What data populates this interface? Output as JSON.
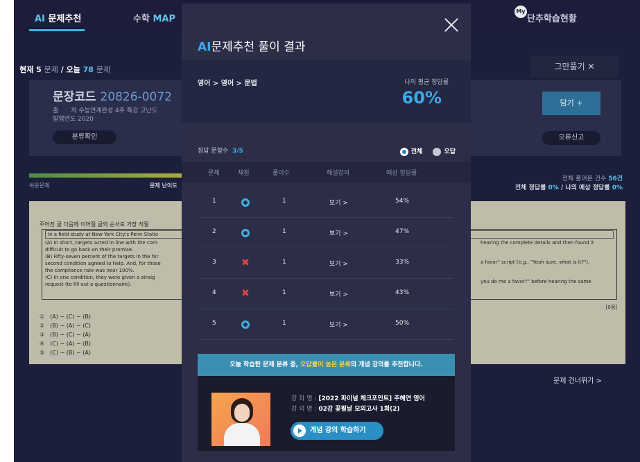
{
  "background": {
    "nav": {
      "tab1_prefix": "AI",
      "tab1_label": "문제추천",
      "tab2_label": "수학",
      "tab2_suffix": "MAP",
      "my_badge": "My",
      "tab3_label": "단추학습현황"
    },
    "counter": {
      "current_label": "현재",
      "current_num": "5",
      "current_unit": "문제",
      "sep": "/",
      "today_label": "오늘",
      "today_num": "78",
      "today_unit": "문제"
    },
    "stop_button": "그만풀기",
    "code": {
      "title": "문장코드",
      "number": "20826-0072",
      "source_label": "출　　처",
      "source_value": "수능연계완성 4주 특강 고난도",
      "year_label": "발행연도",
      "year_value": "2020",
      "classify_button": "분류확인",
      "add_button": "담기 +",
      "report_button": "오류신고"
    },
    "difficulty": {
      "easy_label": "쉬운문제",
      "level_label": "문제 난이도"
    },
    "stats": {
      "line1_prefix": "전체 풀어본 건수",
      "line1_value": "56건",
      "line2_prefix": "전체 정답률",
      "line2_value1": "0%",
      "line2_mid": "/ 나의 예상 정답률",
      "line2_value2": "0%"
    },
    "question": {
      "stem": "주어진 글 다음에 이어질 글의 순서로 가장 적절",
      "box_intro": "In a field study at New York City's Penn Statio",
      "para_a_1": "(A) In short, targets acted in line with the com",
      "para_a_2": "difficult to go back on their promise.",
      "para_b_1": "(B) Fifty-seven percent of the targets in the for",
      "para_b_2": "second condition agreed to help. And, for those",
      "para_b_3": "the compliance rate was near 100%.",
      "para_c_1": "(C) In one condition, they were given a straig",
      "para_c_2": "request (to fill out a questionnaire).",
      "right_1": "hearing the complete details and then found it",
      "right_2": "a favor\" script (e.g., \"Yeah sure, what is it?\"),",
      "right_3": "you do me a favor?\" before hearing the same",
      "score": "[0점]",
      "options": [
        "①　(A) − (C) − (B)",
        "②　(B) − (A) − (C)",
        "③　(B) − (C) − (A)",
        "④　(C) − (A) − (B)",
        "⑤　(C) − (B) − (A)"
      ]
    },
    "skip_link": "문제 건너뛰기 >"
  },
  "modal": {
    "title_prefix": "AI",
    "title_rest": "문제추천 풀이 결과",
    "breadcrumb": "영어  >  영어  >  문법",
    "avg_label": "나의 평균 정답률",
    "avg_value": "60%",
    "correct_label": "정답 문항수",
    "correct_value": "3/5",
    "filters": {
      "all": "전체",
      "wrong": "오답"
    },
    "table": {
      "headers": [
        "문제",
        "채점",
        "풀이수",
        "해설강의",
        "예상 정답률"
      ],
      "rows": [
        {
          "num": "1",
          "result": "correct",
          "attempts": "1",
          "lecture": "보기 >",
          "rate": "54%"
        },
        {
          "num": "2",
          "result": "correct",
          "attempts": "1",
          "lecture": "보기 >",
          "rate": "47%"
        },
        {
          "num": "3",
          "result": "wrong",
          "attempts": "1",
          "lecture": "보기 >",
          "rate": "33%"
        },
        {
          "num": "4",
          "result": "wrong",
          "attempts": "1",
          "lecture": "보기 >",
          "rate": "43%"
        },
        {
          "num": "5",
          "result": "correct",
          "attempts": "1",
          "lecture": "보기 >",
          "rate": "50%"
        }
      ]
    },
    "recommend": {
      "banner_1": "오늘 학습한 문제 분류 중, ",
      "banner_hl": "오답률이 높은 분류",
      "banner_2": "의 개념 강의를 추천합니다.",
      "course_label": "강 좌 명 :",
      "course_value": "[2022 파이널 체크포인트] 주혜연 영어",
      "lecture_label": "강 의 명 :",
      "lecture_value": "02강 꽃필날 모의고사 1회(2)",
      "learn_button": "개념 강의 학습하기"
    },
    "colors": {
      "accent": "#3fa8e8",
      "wrong": "#e2443f",
      "highlight": "#ffcf47"
    }
  }
}
